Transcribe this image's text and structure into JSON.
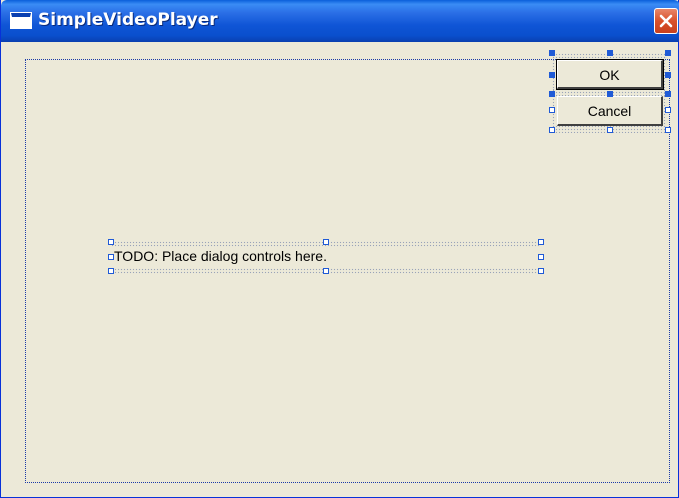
{
  "window": {
    "title": "SimpleVideoPlayer",
    "title_icon": "window-icon",
    "close_icon": "close-icon",
    "accent_color": "#0a4fcd",
    "close_color": "#d9512b",
    "client_background": "#ece9d8"
  },
  "dialog": {
    "ok_label": "OK",
    "cancel_label": "Cancel",
    "static_text": "TODO: Place dialog controls here."
  },
  "editor": {
    "selection_handle_color": "#1f5ad6"
  }
}
